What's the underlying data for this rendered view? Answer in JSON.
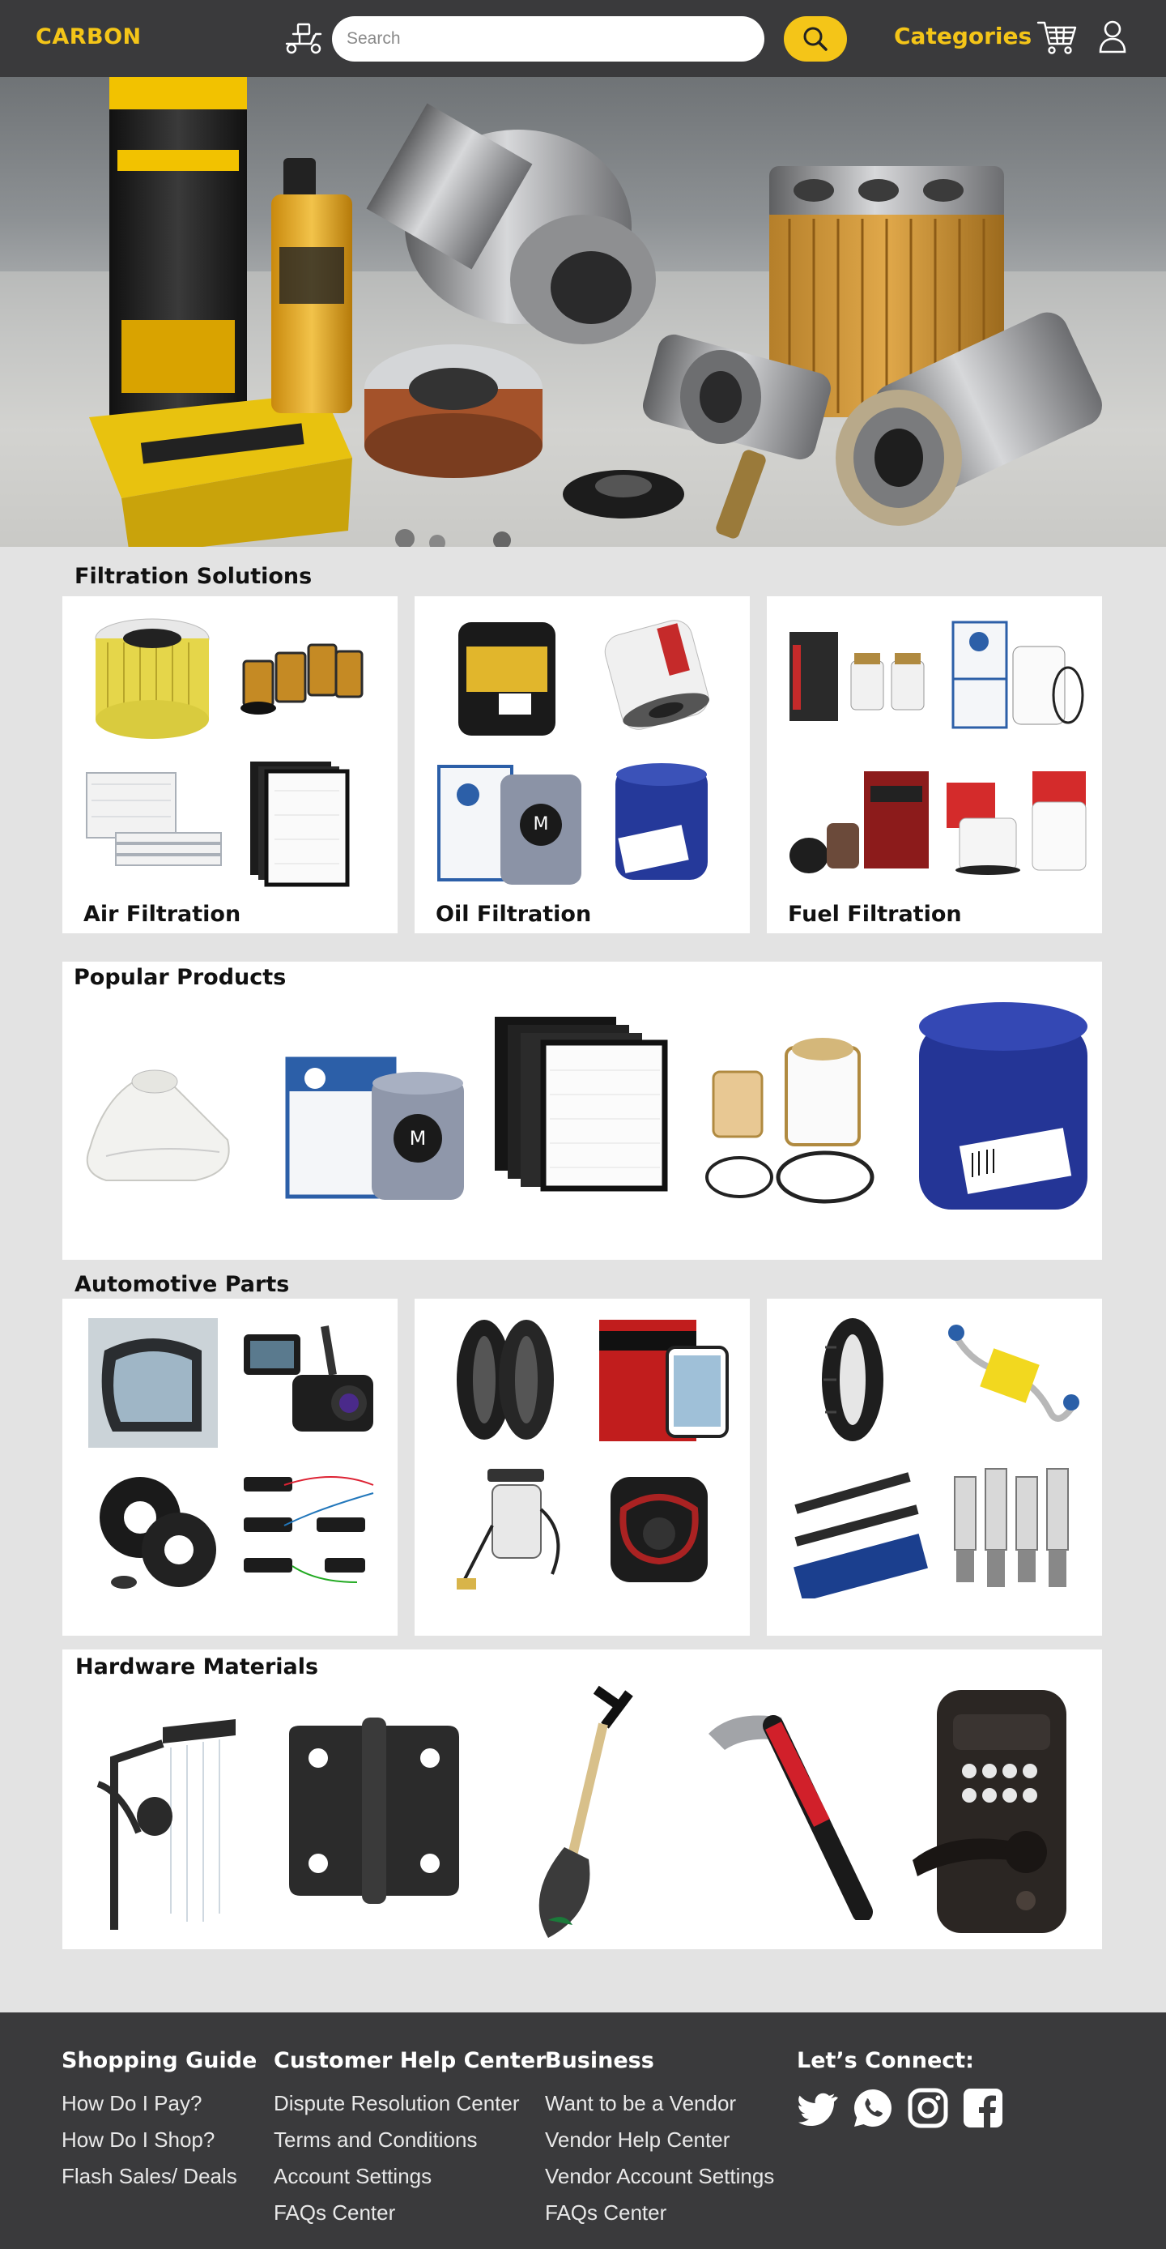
{
  "header": {
    "logo": "CARBON",
    "search_placeholder": "Search",
    "categories_label": "Categories",
    "icons": [
      "delivery-scooter-icon",
      "search-icon",
      "cart-icon",
      "user-icon"
    ]
  },
  "colors": {
    "accent": "#f4c518",
    "header_bg": "#3a3a3c",
    "page_bg": "#e3e3e3",
    "card_bg": "#ffffff"
  },
  "filtration": {
    "title": "Filtration Solutions",
    "cards": [
      {
        "label": "Air Filtration"
      },
      {
        "label": "Oil Filtration"
      },
      {
        "label": "Fuel Filtration"
      }
    ]
  },
  "popular": {
    "title": "Popular Products"
  },
  "automotive": {
    "title": "Automotive Parts"
  },
  "hardware": {
    "title": "Hardware Materials"
  },
  "footer": {
    "shopping": {
      "title": "Shopping Guide",
      "links": [
        "How Do I Pay?",
        "How Do I Shop?",
        "Flash Sales/ Deals"
      ]
    },
    "help": {
      "title": "Customer Help Center",
      "links": [
        "Dispute Resolution Center",
        "Terms and Conditions",
        "Account Settings",
        "FAQs Center"
      ]
    },
    "business": {
      "title": "Business",
      "links": [
        "Want to be a Vendor",
        "Vendor Help Center",
        "Vendor Account Settings",
        "FAQs Center"
      ]
    },
    "connect": {
      "title": "Let’s Connect:",
      "icons": [
        "twitter-icon",
        "whatsapp-icon",
        "instagram-icon",
        "facebook-icon"
      ]
    }
  }
}
